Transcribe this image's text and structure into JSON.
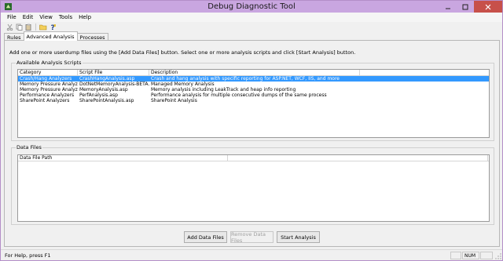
{
  "window": {
    "title": "Debug Diagnostic Tool",
    "accent_color": "#c9a6e0",
    "close_color": "#c7504a"
  },
  "menu": [
    "File",
    "Edit",
    "View",
    "Tools",
    "Help"
  ],
  "toolbar": [
    "cut-icon",
    "copy-icon",
    "paste-icon",
    "open-folder-icon",
    "help-icon"
  ],
  "tabs": [
    {
      "label": "Rules",
      "active": false
    },
    {
      "label": "Advanced Analysis",
      "active": true
    },
    {
      "label": "Processes",
      "active": false
    }
  ],
  "instructions": "Add one or more userdump files using the [Add Data Files] button. Select one or more analysis scripts and click [Start Analysis] button.",
  "scripts_group": {
    "label": "Available Analysis Scripts",
    "columns": [
      "Category",
      "Script File",
      "Description"
    ],
    "rows": [
      {
        "category": "Crash/Hang Analyzers",
        "file": "CrashHangAnalysis.asp",
        "description": "Crash and hang analysis with specific reporting for ASP.NET, WCF, IIS, and more",
        "selected": true
      },
      {
        "category": "Memory Pressure Analyzers",
        "file": "DotNetMemoryAnalysis-BETA.asp",
        "description": "Managed Memory Analysis",
        "selected": false
      },
      {
        "category": "Memory Pressure Analyzers",
        "file": "MemoryAnalysis.asp",
        "description": "Memory analysis including LeakTrack and heap info reporting",
        "selected": false
      },
      {
        "category": "Performance Analyzers",
        "file": "PerfAnalysis.asp",
        "description": "Performance analysis for multiple consecutive dumps of the same process",
        "selected": false
      },
      {
        "category": "SharePoint Analyzers",
        "file": "SharePointAnalysis.asp",
        "description": "SharePoint Analysis",
        "selected": false
      }
    ],
    "selection_color": "#3399ff"
  },
  "datafiles_group": {
    "label": "Data Files",
    "columns": [
      "Data File Path",
      ""
    ]
  },
  "buttons": {
    "add": "Add Data Files",
    "remove": "Remove Data Files",
    "start": "Start Analysis"
  },
  "status": {
    "text": "For Help, press F1",
    "num": "NUM"
  }
}
